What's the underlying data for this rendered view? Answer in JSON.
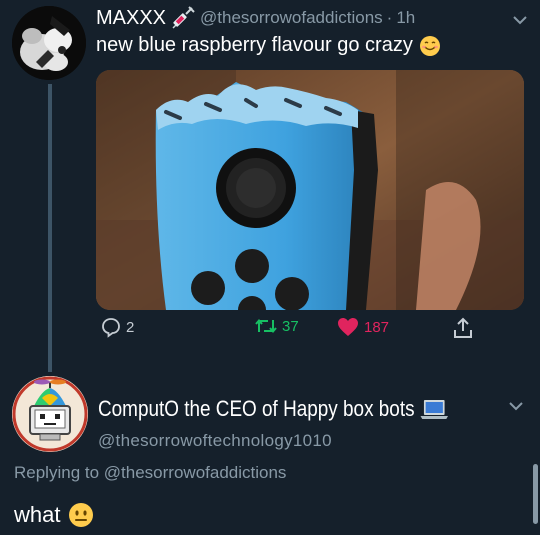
{
  "tweet": {
    "display_name": "MAXXX",
    "name_emoji_icon": "syringe-icon",
    "handle": "@thesorrowofaddictions",
    "separator": "·",
    "time": "1h",
    "text": "new blue raspberry flavour go crazy",
    "text_emoji_icon": "smiling-face-icon",
    "media_description_icon": "bitten-joycon-photo",
    "stats": {
      "replies": "2",
      "retweets": "37",
      "likes": "187"
    }
  },
  "reply": {
    "display_name": "ComputO the CEO of Happy box bots",
    "name_emoji_icon": "laptop-icon",
    "handle": "@thesorrowoftechnology1010",
    "replying_prefix": "Replying to",
    "replying_to": "@thesorrowofaddictions",
    "text": "what",
    "text_emoji_icon": "neutral-face-icon"
  },
  "colors": {
    "background": "#15202b",
    "secondary_text": "#8899a6",
    "retweet_green": "#17bf63",
    "like_pink": "#e0245e",
    "thread_line": "#3d5466"
  }
}
